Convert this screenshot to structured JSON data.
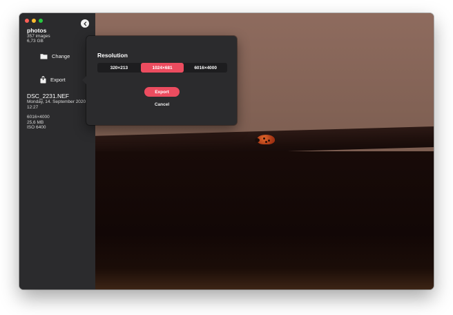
{
  "sidebar": {
    "library": {
      "name": "photos",
      "count": "357 images",
      "size": "6,73 GB"
    },
    "buttons": {
      "change": "Change",
      "export": "Export"
    },
    "file": {
      "name": "DSC_2231.NEF",
      "date": "Monday, 14. September 2020 at 12:27",
      "dimensions": "6016×4000",
      "size": "25,6 MB",
      "iso": "ISO 6400"
    }
  },
  "popover": {
    "title": "Resolution",
    "options": [
      "320×213",
      "1024×681",
      "6016×4000"
    ],
    "selected": "1024×681",
    "export_label": "Export",
    "cancel_label": "Cancel"
  },
  "icons": {
    "back": "chevron-left-icon",
    "folder": "folder-icon",
    "share": "share-icon"
  },
  "colors": {
    "accent": "#ec4c5f",
    "sidebar_bg": "#2b2b2d",
    "segment_bg": "#1d1d1f"
  }
}
